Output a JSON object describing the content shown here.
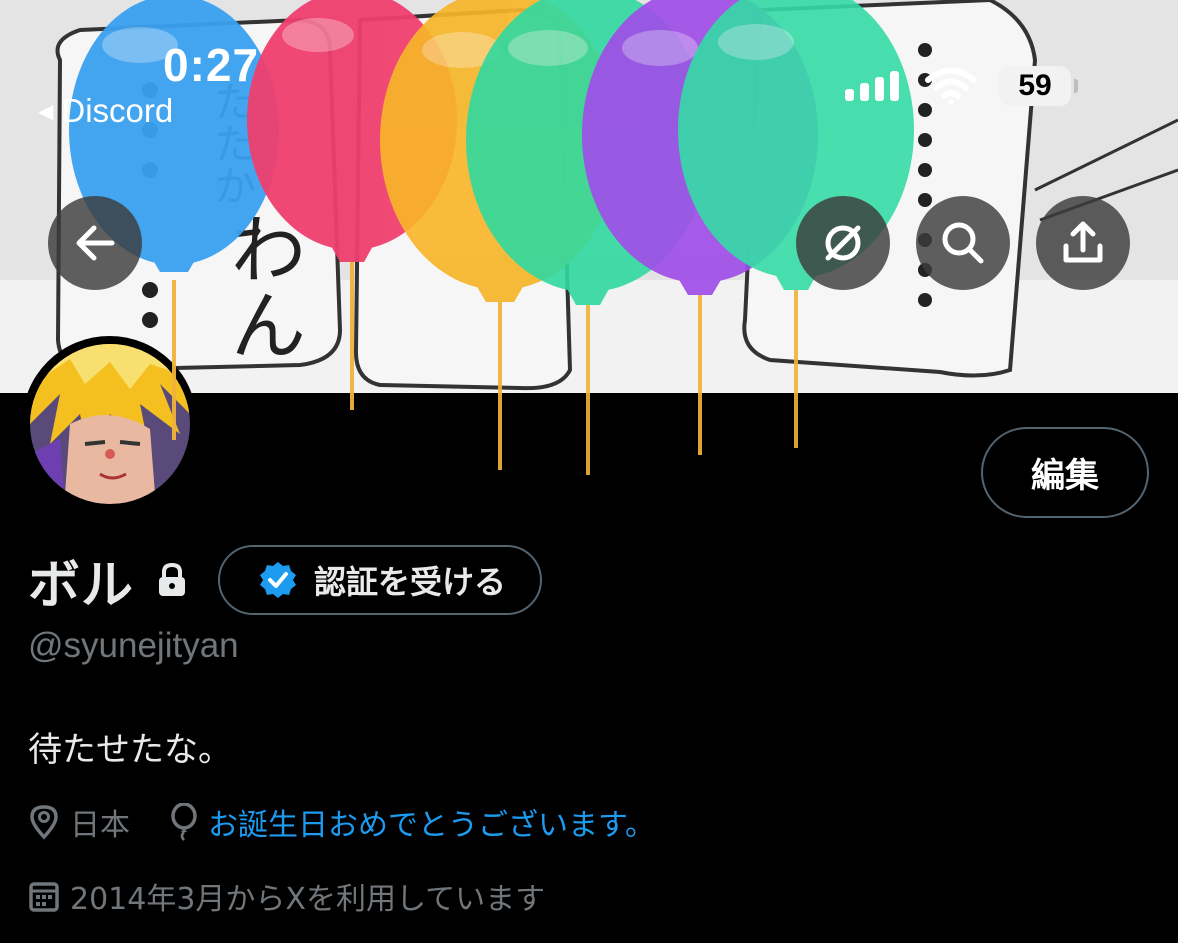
{
  "status_bar": {
    "time": "0:27",
    "back_app": "Discord",
    "battery": "59"
  },
  "header": {
    "back_icon": "arrow-left-icon",
    "icons": [
      "arrow-left-icon",
      "no-tracking-icon",
      "search-icon",
      "share-icon"
    ]
  },
  "banner_text": [
    "たたか",
    "わん"
  ],
  "balloons": {
    "colors": [
      "#3aa0f0",
      "#ef3f6e",
      "#f7b52a",
      "#30d9a0",
      "#a04ee8",
      "#35dba6"
    ]
  },
  "profile": {
    "display_name": "ボル",
    "handle": "@syunejityan",
    "bio": "待たせたな。",
    "edit_label": "編集",
    "verify_label": "認証を受ける",
    "location": "日本",
    "birthday_text": "お誕生日おめでとうございます。",
    "joined": "2014年3月からXを利用しています"
  },
  "colors": {
    "accent": "#1d9bf0",
    "muted": "#71767b",
    "border": "#536471"
  }
}
